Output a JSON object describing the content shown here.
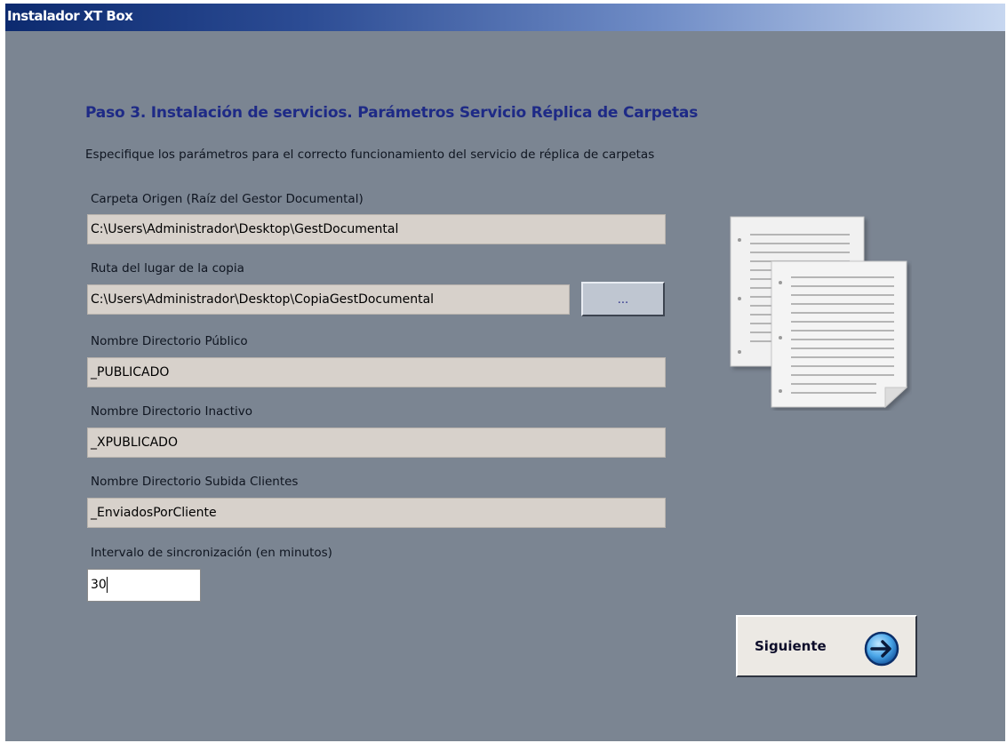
{
  "window": {
    "title": "Instalador XT Box"
  },
  "main": {
    "heading": "Paso 3. Instalación de servicios. Parámetros Servicio Réplica de Carpetas",
    "description": "Especifique los parámetros para el correcto funcionamiento del servicio de réplica de carpetas"
  },
  "fields": {
    "origin": {
      "label": "Carpeta Origen (Raíz del Gestor Documental)",
      "value": "C:\\Users\\Administrador\\Desktop\\GestDocumental"
    },
    "copy": {
      "label": "Ruta del lugar de la copia",
      "value": "C:\\Users\\Administrador\\Desktop\\CopiaGestDocumental",
      "browse_label": "..."
    },
    "public_dir": {
      "label": "Nombre Directorio Público",
      "value": "_PUBLICADO"
    },
    "inactive_dir": {
      "label": "Nombre Directorio Inactivo",
      "value": "_XPUBLICADO"
    },
    "upload_dir": {
      "label": "Nombre Directorio Subida Clientes",
      "value": "_EnviadosPorCliente"
    },
    "interval": {
      "label": "Intervalo de sincronización (en minutos)",
      "value": "30"
    }
  },
  "buttons": {
    "next_label": "Siguiente",
    "next_icon": "arrow-right-circle-icon"
  },
  "illustration": {
    "icon": "documents-icon"
  },
  "colors": {
    "background": "#7b8592",
    "heading": "#1e2a86",
    "field_bg": "#d7d1cb",
    "titlebar": "#0c2a6f"
  }
}
